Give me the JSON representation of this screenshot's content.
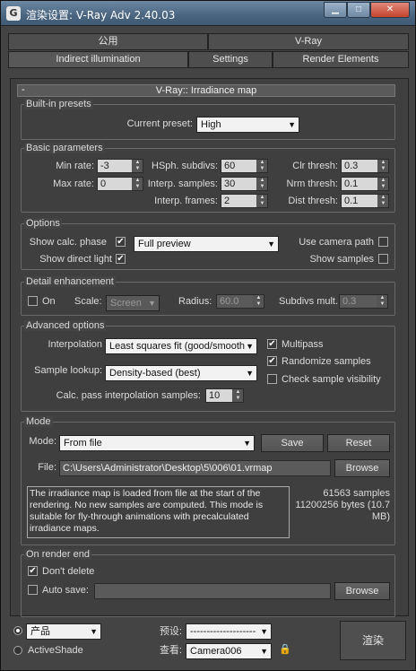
{
  "window": {
    "title": "渲染设置: V-Ray Adv 2.40.03",
    "app_icon_label": "G"
  },
  "tabs": {
    "row1": [
      "公用",
      "V-Ray"
    ],
    "row2": [
      "Indirect illumination",
      "Settings",
      "Render Elements"
    ]
  },
  "rollout": {
    "collapse_symbol": "-",
    "title": "V-Ray:: Irradiance map"
  },
  "builtin_presets": {
    "label": "Built-in presets",
    "current_preset_label": "Current preset:",
    "current_preset": "High"
  },
  "basic_parameters": {
    "label": "Basic parameters",
    "min_rate_label": "Min rate:",
    "min_rate": "-3",
    "max_rate_label": "Max rate:",
    "max_rate": "0",
    "hsph_label": "HSph. subdivs:",
    "hsph": "60",
    "interp_samples_label": "Interp. samples:",
    "interp_samples": "30",
    "interp_frames_label": "Interp. frames:",
    "interp_frames": "2",
    "clr_thresh_label": "Clr thresh:",
    "clr_thresh": "0.3",
    "nrm_thresh_label": "Nrm thresh:",
    "nrm_thresh": "0.1",
    "dist_thresh_label": "Dist thresh:",
    "dist_thresh": "0.1"
  },
  "options": {
    "label": "Options",
    "show_calc_phase": "Show calc. phase",
    "show_calc_phase_checked": true,
    "show_direct_light": "Show direct light",
    "show_direct_light_checked": true,
    "preview_mode": "Full preview",
    "use_camera_path": "Use camera path",
    "use_camera_path_checked": false,
    "show_samples": "Show samples",
    "show_samples_checked": false
  },
  "detail_enhancement": {
    "label": "Detail enhancement",
    "on_label": "On",
    "on_checked": false,
    "scale_label": "Scale:",
    "scale": "Screen",
    "radius_label": "Radius:",
    "radius": "60.0",
    "subdivs_mult_label": "Subdivs mult.",
    "subdivs_mult": "0.3"
  },
  "advanced_options": {
    "label": "Advanced options",
    "interpolation_label": "Interpolation",
    "interpolation": "Least squares fit (good/smooth",
    "sample_lookup_label": "Sample lookup:",
    "sample_lookup": "Density-based (best)",
    "calc_pass_label": "Calc. pass interpolation samples:",
    "calc_pass": "10",
    "multipass": "Multipass",
    "multipass_checked": true,
    "randomize_samples": "Randomize samples",
    "randomize_samples_checked": true,
    "check_sample_visibility": "Check sample visibility",
    "check_sample_visibility_checked": false
  },
  "mode": {
    "label": "Mode",
    "mode_label": "Mode:",
    "mode_value": "From file",
    "save_button": "Save",
    "reset_button": "Reset",
    "file_label": "File:",
    "file_path": "C:\\Users\\Administrator\\Desktop\\5\\006\\01.vrmap",
    "browse_button": "Browse",
    "description": "The irradiance map is loaded from file at the start of the rendering. No new samples are computed. This mode is suitable for fly-through animations with precalculated irradiance maps.",
    "samples_text": "61563 samples",
    "bytes_text": "11200256 bytes (10.7",
    "mb_text": "MB)"
  },
  "on_render_end": {
    "label": "On render end",
    "dont_delete": "Don't delete",
    "dont_delete_checked": true,
    "auto_save": "Auto save:",
    "auto_save_checked": false,
    "auto_save_path": "",
    "browse_button": "Browse"
  },
  "bottom_bar": {
    "product_label": "产品",
    "activeshade_label": "ActiveShade",
    "preset_label": "预设:",
    "preset_value": "--------------------",
    "view_label": "查看:",
    "view_value": "Camera006",
    "render_button": "渲染"
  }
}
